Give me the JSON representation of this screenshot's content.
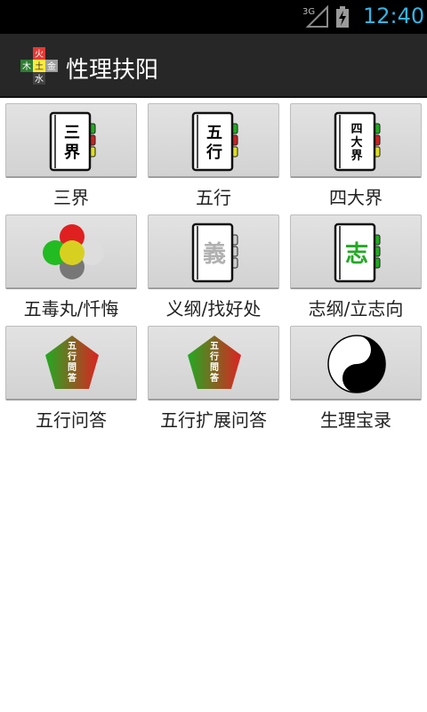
{
  "status_bar": {
    "network": "3G",
    "time": "12:40",
    "accent_color": "#33b5e5"
  },
  "action_bar": {
    "app_icon": {
      "chars": [
        "火",
        "木",
        "土",
        "金",
        "水"
      ],
      "colors": [
        "#e53935",
        "#2e7d32",
        "#ffeb3b",
        "#9e9e9e",
        "#424242"
      ]
    },
    "title": "性理扶阳"
  },
  "grid": {
    "items": [
      {
        "label": "三界",
        "icon": "book-icon",
        "book_text": [
          "三",
          "界"
        ],
        "text_color": "#000000",
        "tabs": [
          "#22aa22",
          "#cc2222",
          "#dddd22"
        ]
      },
      {
        "label": "五行",
        "icon": "book-icon",
        "book_text": [
          "五",
          "行"
        ],
        "text_color": "#000000",
        "tabs": [
          "#22aa22",
          "#cc2222",
          "#dddd22"
        ]
      },
      {
        "label": "四大界",
        "icon": "book-icon",
        "book_text": [
          "四",
          "大",
          "界"
        ],
        "text_color": "#000000",
        "tabs": [
          "#22aa22",
          "#cc2222",
          "#dddd22"
        ]
      },
      {
        "label": "五毒丸/忏悔",
        "icon": "five-circles-icon",
        "colors": [
          "#e02020",
          "#22bb22",
          "#dddddd",
          "#d8d020",
          "#777777"
        ]
      },
      {
        "label": "义纲/找好处",
        "icon": "book-icon",
        "book_text": [
          "義"
        ],
        "text_color": "#b0b0b0",
        "tabs": [
          "#cccccc",
          "#cccccc",
          "#cccccc"
        ]
      },
      {
        "label": "志纲/立志向",
        "icon": "book-icon",
        "book_text": [
          "志"
        ],
        "text_color": "#22aa22",
        "tabs": [
          "#22aa22",
          "#22aa22",
          "#22aa22"
        ]
      },
      {
        "label": "五行问答",
        "icon": "pentagon-icon",
        "pentagon_text": [
          "五",
          "行",
          "問",
          "答"
        ]
      },
      {
        "label": "五行扩展问答",
        "icon": "pentagon-icon",
        "pentagon_text": [
          "五",
          "行",
          "問",
          "答"
        ]
      },
      {
        "label": "生理宝录",
        "icon": "yin-yang-icon"
      }
    ]
  }
}
